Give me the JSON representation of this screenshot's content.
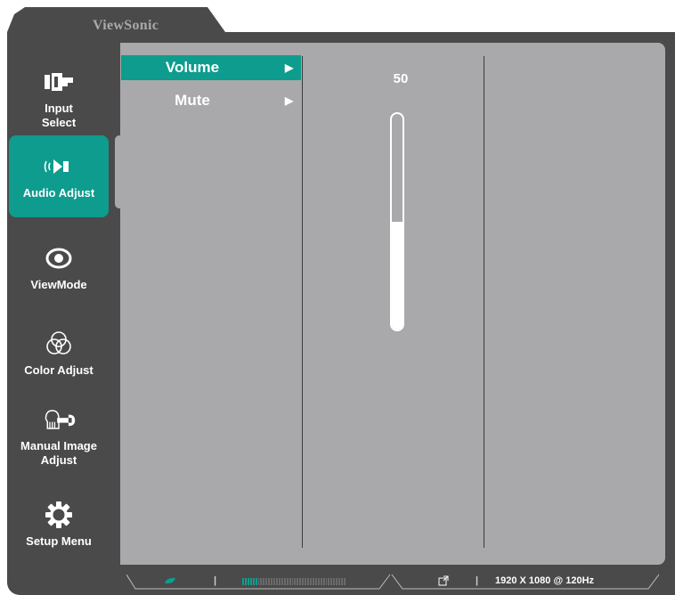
{
  "brand": "ViewSonic",
  "sidebar": {
    "items": [
      {
        "label": "Input Select",
        "icon": "input-select-icon",
        "active": false
      },
      {
        "label": "Audio Adjust",
        "icon": "speaker-icon",
        "active": true
      },
      {
        "label": "ViewMode",
        "icon": "eye-icon",
        "active": false
      },
      {
        "label": "Color Adjust",
        "icon": "color-circles-icon",
        "active": false
      },
      {
        "label": "Manual Image Adjust",
        "icon": "hand-wrench-icon",
        "active": false
      },
      {
        "label": "Setup Menu",
        "icon": "gear-icon",
        "active": false
      }
    ]
  },
  "submenu": {
    "items": [
      {
        "label": "Volume",
        "arrow": "▶",
        "active": true
      },
      {
        "label": "Mute",
        "arrow": "▶",
        "active": false
      }
    ]
  },
  "volume": {
    "value": "50",
    "level_fraction": 0.5
  },
  "statusbar": {
    "resolution": "1920 X 1080 @ 120Hz",
    "meter_segments_on": 6,
    "meter_segments_total": 40
  },
  "colors": {
    "accent": "#0e9c8e",
    "panel": "#a9a9ab",
    "frame": "#4a4a4a"
  }
}
